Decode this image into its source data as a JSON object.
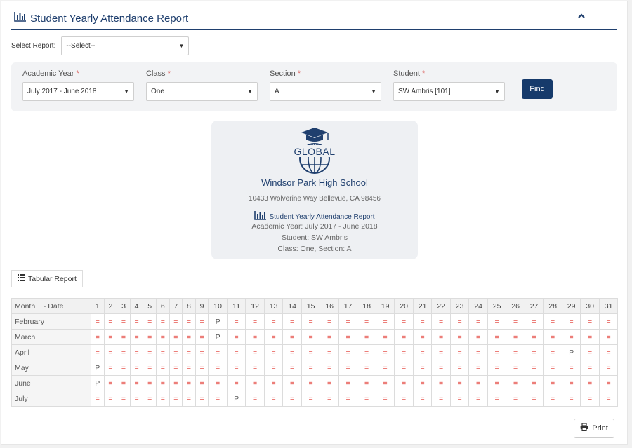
{
  "header": {
    "title": "Student Yearly Attendance Report"
  },
  "select_report": {
    "label": "Select Report:",
    "value": "--Select--"
  },
  "filters": {
    "academic_year": {
      "label": "Academic Year",
      "value": "July 2017 - June 2018"
    },
    "class": {
      "label": "Class",
      "value": "One"
    },
    "section": {
      "label": "Section",
      "value": "A"
    },
    "student": {
      "label": "Student",
      "value": "SW Ambris [101]"
    },
    "required_mark": "*",
    "find_label": "Find"
  },
  "card": {
    "logo_text": "GLOBAL",
    "school_name": "Windsor Park High School",
    "address": "10433 Wolverine Way Bellevue, CA 98456",
    "report_title": "Student Yearly Attendance Report",
    "academic_year": "Academic Year: July 2017 - June 2018",
    "student": "Student: SW Ambris",
    "class_section": "Class: One, Section: A"
  },
  "tab": {
    "label": "Tabular Report"
  },
  "table": {
    "month_header": "Month",
    "date_header": "- Date",
    "days": [
      "1",
      "2",
      "3",
      "4",
      "5",
      "6",
      "7",
      "8",
      "9",
      "10",
      "11",
      "12",
      "13",
      "14",
      "15",
      "16",
      "17",
      "18",
      "19",
      "20",
      "21",
      "22",
      "23",
      "24",
      "25",
      "26",
      "27",
      "28",
      "29",
      "30",
      "31"
    ],
    "rows": [
      {
        "month": "February",
        "cells": [
          "=",
          "=",
          "=",
          "=",
          "=",
          "=",
          "=",
          "=",
          "=",
          "P",
          "=",
          "=",
          "=",
          "=",
          "=",
          "=",
          "=",
          "=",
          "=",
          "=",
          "=",
          "=",
          "=",
          "=",
          "=",
          "=",
          "=",
          "=",
          "=",
          "=",
          "="
        ]
      },
      {
        "month": "March",
        "cells": [
          "=",
          "=",
          "=",
          "=",
          "=",
          "=",
          "=",
          "=",
          "=",
          "P",
          "=",
          "=",
          "=",
          "=",
          "=",
          "=",
          "=",
          "=",
          "=",
          "=",
          "=",
          "=",
          "=",
          "=",
          "=",
          "=",
          "=",
          "=",
          "=",
          "=",
          "="
        ]
      },
      {
        "month": "April",
        "cells": [
          "=",
          "=",
          "=",
          "=",
          "=",
          "=",
          "=",
          "=",
          "=",
          "=",
          "=",
          "=",
          "=",
          "=",
          "=",
          "=",
          "=",
          "=",
          "=",
          "=",
          "=",
          "=",
          "=",
          "=",
          "=",
          "=",
          "=",
          "=",
          "P",
          "=",
          "="
        ]
      },
      {
        "month": "May",
        "cells": [
          "P",
          "=",
          "=",
          "=",
          "=",
          "=",
          "=",
          "=",
          "=",
          "=",
          "=",
          "=",
          "=",
          "=",
          "=",
          "=",
          "=",
          "=",
          "=",
          "=",
          "=",
          "=",
          "=",
          "=",
          "=",
          "=",
          "=",
          "=",
          "=",
          "=",
          "="
        ]
      },
      {
        "month": "June",
        "cells": [
          "P",
          "=",
          "=",
          "=",
          "=",
          "=",
          "=",
          "=",
          "=",
          "=",
          "=",
          "=",
          "=",
          "=",
          "=",
          "=",
          "=",
          "=",
          "=",
          "=",
          "=",
          "=",
          "=",
          "=",
          "=",
          "=",
          "=",
          "=",
          "=",
          "=",
          "="
        ]
      },
      {
        "month": "July",
        "cells": [
          "=",
          "=",
          "=",
          "=",
          "=",
          "=",
          "=",
          "=",
          "=",
          "=",
          "P",
          "=",
          "=",
          "=",
          "=",
          "=",
          "=",
          "=",
          "=",
          "=",
          "=",
          "=",
          "=",
          "=",
          "=",
          "=",
          "=",
          "=",
          "=",
          "=",
          "="
        ]
      }
    ]
  },
  "print_label": "Print",
  "colors": {
    "brand": "#1f3f6e",
    "absent": "#e0342b",
    "button": "#163a6b"
  },
  "icons": {
    "report": "bar-chart-icon",
    "collapse": "chevron-up-icon",
    "tab": "list-icon",
    "print": "printer-icon",
    "dropdown": "caret-down-icon"
  }
}
